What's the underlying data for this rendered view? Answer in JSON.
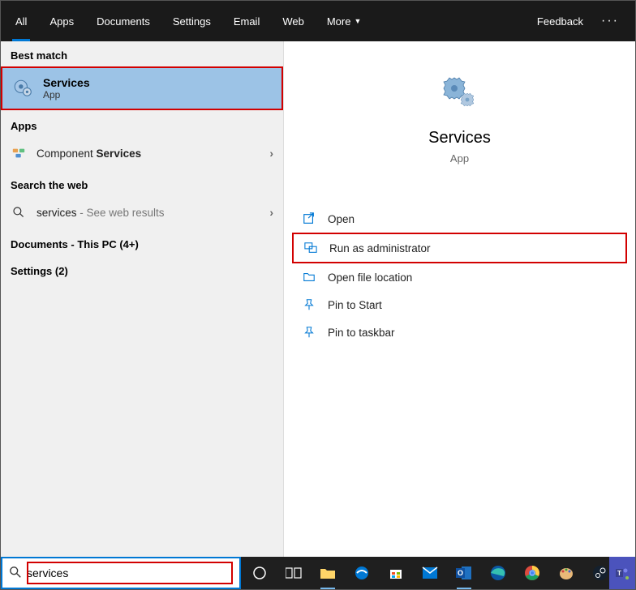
{
  "header": {
    "tabs": [
      "All",
      "Apps",
      "Documents",
      "Settings",
      "Email",
      "Web",
      "More"
    ],
    "active_tab": 0,
    "feedback": "Feedback"
  },
  "left": {
    "best_match_header": "Best match",
    "best_match": {
      "title": "Services",
      "subtitle": "App"
    },
    "apps_header": "Apps",
    "apps_item": {
      "prefix": "Component ",
      "bold": "Services"
    },
    "web_header": "Search the web",
    "web_item": {
      "query": "services",
      "suffix": " - See web results"
    },
    "documents_header": "Documents - This PC (4+)",
    "settings_header": "Settings (2)"
  },
  "preview": {
    "title": "Services",
    "subtitle": "App",
    "actions": [
      {
        "icon": "open",
        "label": "Open"
      },
      {
        "icon": "admin",
        "label": "Run as administrator",
        "highlight": true
      },
      {
        "icon": "folder",
        "label": "Open file location"
      },
      {
        "icon": "pin-start",
        "label": "Pin to Start"
      },
      {
        "icon": "pin-taskbar",
        "label": "Pin to taskbar"
      }
    ]
  },
  "search": {
    "value": "services"
  },
  "taskbar_icons": [
    "cortana",
    "task-view",
    "explorer",
    "edge",
    "store",
    "mail",
    "outlook",
    "edge-chromium",
    "chrome",
    "paint",
    "steam"
  ]
}
